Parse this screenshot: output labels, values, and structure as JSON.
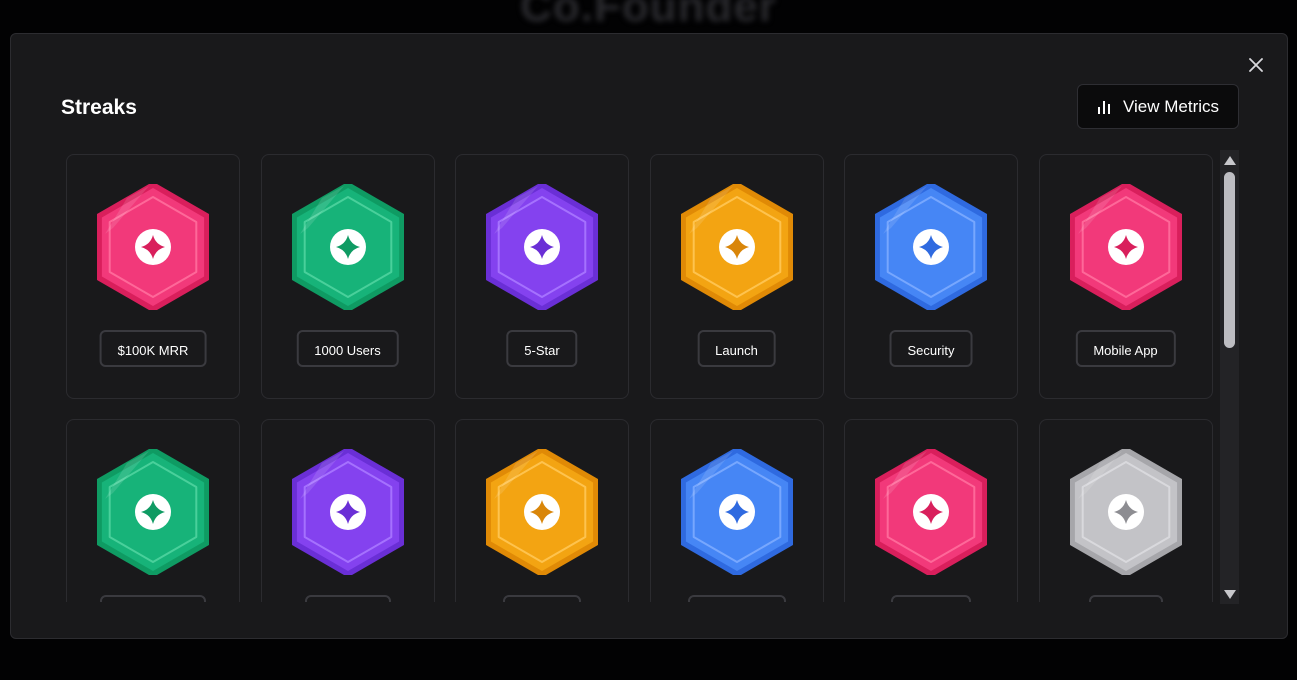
{
  "background": {
    "title": "Co.Founder"
  },
  "modal": {
    "title": "Streaks",
    "view_metrics_label": "View Metrics",
    "close_icon": "close-icon",
    "metrics_icon": "bar-chart-icon"
  },
  "badges": [
    {
      "label": "$100K MRR",
      "color": "pink"
    },
    {
      "label": "1000 Users",
      "color": "green"
    },
    {
      "label": "5-Star",
      "color": "purple"
    },
    {
      "label": "Launch",
      "color": "orange"
    },
    {
      "label": "Security",
      "color": "blue"
    },
    {
      "label": "Mobile App",
      "color": "pink"
    },
    {
      "label": "",
      "color": "green"
    },
    {
      "label": "",
      "color": "purple"
    },
    {
      "label": "",
      "color": "orange"
    },
    {
      "label": "",
      "color": "blue"
    },
    {
      "label": "",
      "color": "pink"
    },
    {
      "label": "",
      "color": "gray"
    }
  ],
  "colors": {
    "pink": {
      "outer": "#d91f5c",
      "inner": "#f2397a",
      "light": "#ff6e9c",
      "star": "#d91f5c"
    },
    "green": {
      "outer": "#0f9b63",
      "inner": "#17b379",
      "light": "#4fd39f",
      "star": "#0f9b63"
    },
    "purple": {
      "outer": "#6a2fd6",
      "inner": "#8442ef",
      "light": "#a877ff",
      "star": "#6a2fd6"
    },
    "orange": {
      "outer": "#e08a06",
      "inner": "#f3a412",
      "light": "#ffc755",
      "star": "#d9860a"
    },
    "blue": {
      "outer": "#2f6ae0",
      "inner": "#4686f5",
      "light": "#7cabff",
      "star": "#2f6ae0"
    },
    "gray": {
      "outer": "#a6a6aa",
      "inner": "#c3c3c7",
      "light": "#dcdcdf",
      "star": "#8d8d92"
    }
  }
}
